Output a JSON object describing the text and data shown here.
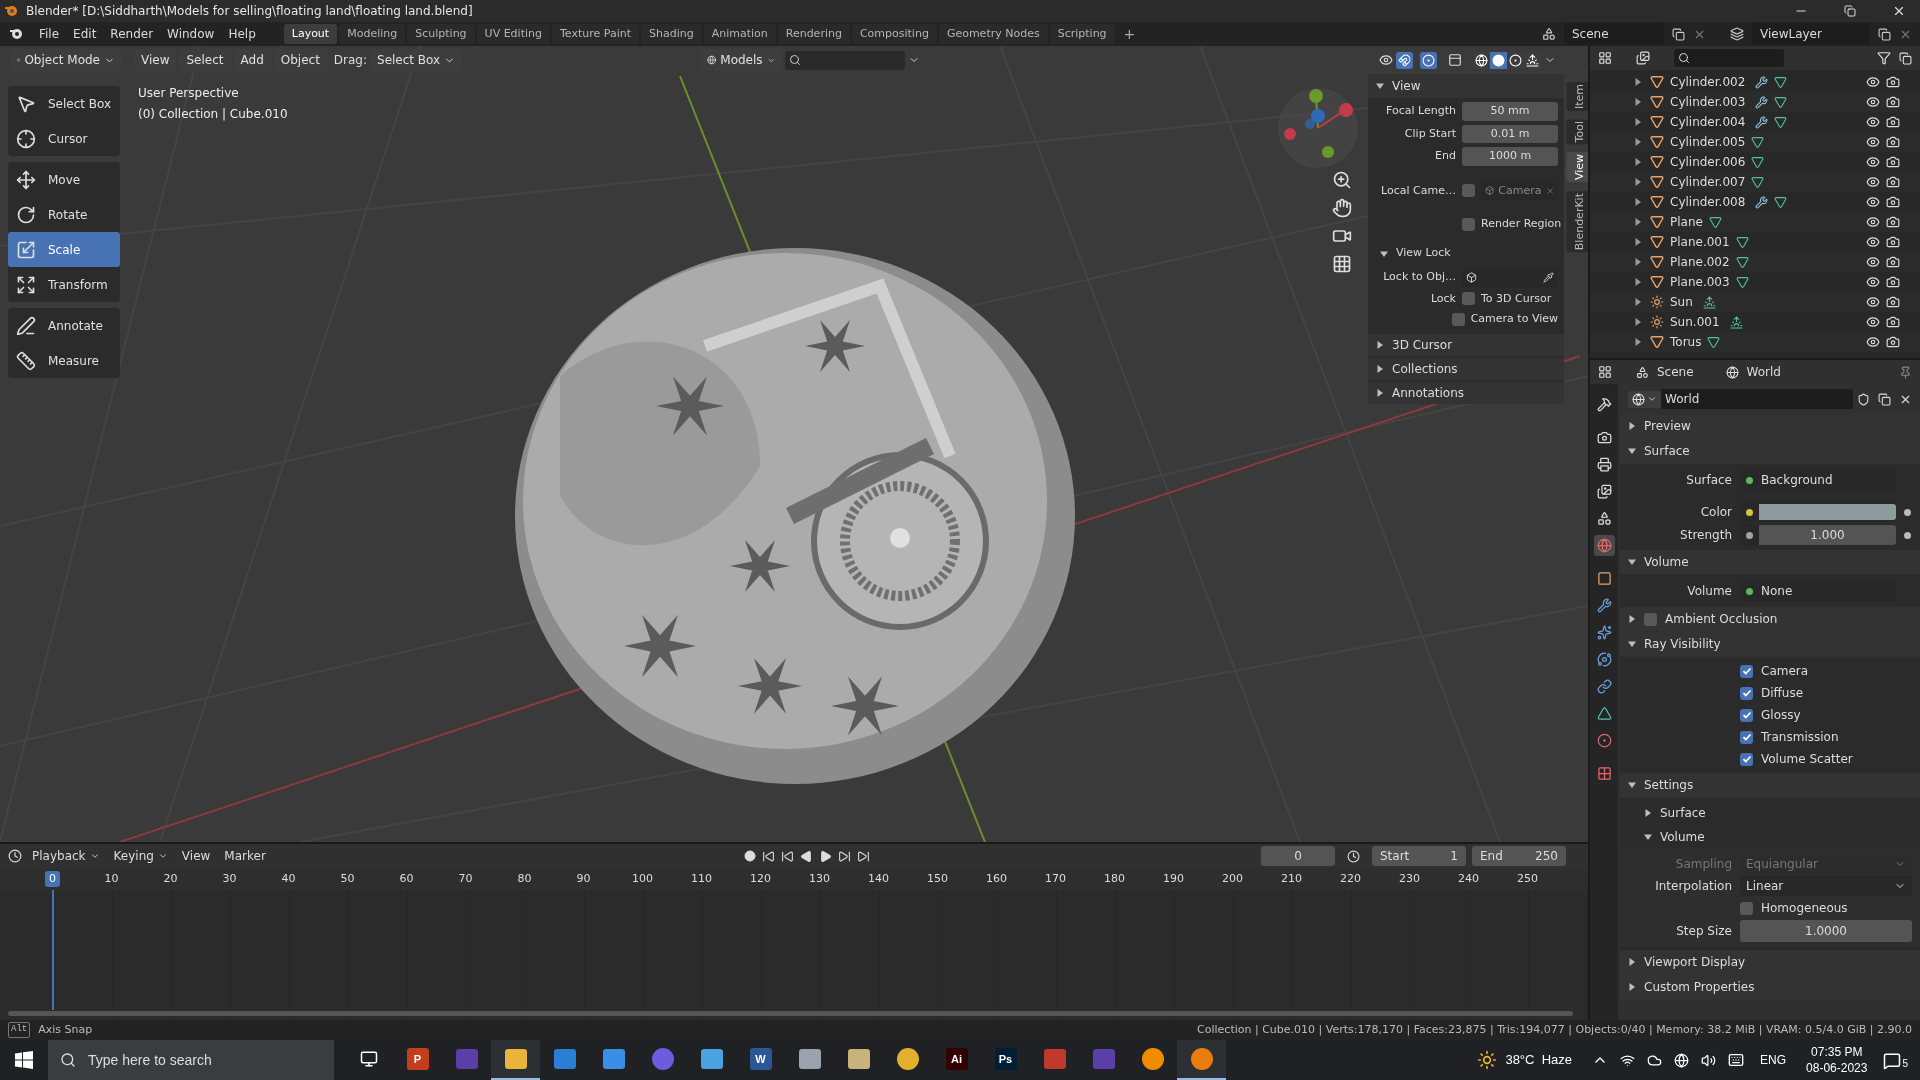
{
  "title_bar": {
    "title": "Blender* [D:\\Siddharth\\Models for selling\\floating land\\floating land.blend]"
  },
  "menu": [
    "File",
    "Edit",
    "Render",
    "Window",
    "Help"
  ],
  "workspaces": [
    {
      "label": "Layout",
      "selected": true
    },
    {
      "label": "Modeling",
      "selected": false
    },
    {
      "label": "Sculpting",
      "selected": false
    },
    {
      "label": "UV Editing",
      "selected": false
    },
    {
      "label": "Texture Paint",
      "selected": false
    },
    {
      "label": "Shading",
      "selected": false
    },
    {
      "label": "Animation",
      "selected": false
    },
    {
      "label": "Rendering",
      "selected": false
    },
    {
      "label": "Compositing",
      "selected": false
    },
    {
      "label": "Geometry Nodes",
      "selected": false
    },
    {
      "label": "Scripting",
      "selected": false
    }
  ],
  "add_workspace": "+",
  "scene": "Scene",
  "view_layer": "ViewLayer",
  "viewport": {
    "header": {
      "mode": "Object Mode",
      "menus": [
        "View",
        "Select",
        "Add",
        "Object"
      ],
      "drag_label": "Drag:",
      "drag_value": "Select Box",
      "orientation": "Models",
      "shading": [
        {
          "kind": "wireframe",
          "selected": false
        },
        {
          "kind": "solid",
          "selected": true
        },
        {
          "kind": "material",
          "selected": false
        },
        {
          "kind": "rendered",
          "selected": false
        }
      ]
    },
    "overlay_text": [
      "User Perspective",
      "(0) Collection | Cube.010"
    ],
    "tool_groups": [
      [
        {
          "label": "Select Box",
          "kind": "select",
          "selected": false
        },
        {
          "label": "Cursor",
          "kind": "cursor",
          "selected": false
        }
      ],
      [
        {
          "label": "Move",
          "kind": "move",
          "selected": false
        },
        {
          "label": "Rotate",
          "kind": "rotate",
          "selected": false
        },
        {
          "label": "Scale",
          "kind": "scale",
          "selected": true
        },
        {
          "label": "Transform",
          "kind": "transform",
          "selected": false
        }
      ],
      [
        {
          "label": "Annotate",
          "kind": "annotate",
          "selected": false
        },
        {
          "label": "Measure",
          "kind": "measure",
          "selected": false
        }
      ]
    ],
    "n_panel": {
      "tabs": [
        {
          "label": "Item",
          "selected": false
        },
        {
          "label": "Tool",
          "selected": false
        },
        {
          "label": "View",
          "selected": true
        },
        {
          "label": "BlenderKit",
          "selected": false
        }
      ],
      "view": {
        "title": "View",
        "expanded": true,
        "fields": [
          {
            "label": "Focal Length",
            "value": "50 mm"
          },
          {
            "label": "Clip Start",
            "value": "0.01 m"
          },
          {
            "label": "End",
            "value": "1000 m"
          }
        ],
        "local_camera": {
          "label": "Local Came…",
          "checked": false,
          "placeholder": "Camera"
        },
        "render_region": {
          "label": "Render Region",
          "checked": false
        },
        "view_lock": {
          "title": "View Lock",
          "expanded": true,
          "lock_to_label": "Lock to Obj…",
          "lock_label": "Lock",
          "options": [
            {
              "label": "To 3D Cursor",
              "checked": false
            },
            {
              "label": "Camera to View",
              "checked": false
            }
          ]
        }
      },
      "sections": [
        {
          "title": "3D Cursor",
          "expanded": false
        },
        {
          "title": "Collections",
          "expanded": false
        },
        {
          "title": "Annotations",
          "expanded": false
        }
      ]
    }
  },
  "outliner": {
    "items": [
      {
        "name": "Cylinder.002",
        "kind": "mesh",
        "modifier": true
      },
      {
        "name": "Cylinder.003",
        "kind": "mesh",
        "modifier": true
      },
      {
        "name": "Cylinder.004",
        "kind": "mesh",
        "modifier": true
      },
      {
        "name": "Cylinder.005",
        "kind": "mesh",
        "modifier": false
      },
      {
        "name": "Cylinder.006",
        "kind": "mesh",
        "modifier": false
      },
      {
        "name": "Cylinder.007",
        "kind": "mesh",
        "modifier": false
      },
      {
        "name": "Cylinder.008",
        "kind": "mesh",
        "modifier": true
      },
      {
        "name": "Plane",
        "kind": "mesh",
        "modifier": false
      },
      {
        "name": "Plane.001",
        "kind": "mesh",
        "modifier": false
      },
      {
        "name": "Plane.002",
        "kind": "mesh",
        "modifier": false
      },
      {
        "name": "Plane.003",
        "kind": "mesh",
        "modifier": false
      },
      {
        "name": "Sun",
        "kind": "light",
        "modifier": false
      },
      {
        "name": "Sun.001",
        "kind": "light",
        "modifier": false
      },
      {
        "name": "Torus",
        "kind": "mesh",
        "modifier": false
      }
    ]
  },
  "properties": {
    "context": [
      "Scene",
      "World"
    ],
    "datablock": "World",
    "tabs": [
      {
        "kind": "tool",
        "selected": false
      },
      {
        "kind": "render",
        "selected": false
      },
      {
        "kind": "output",
        "selected": false
      },
      {
        "kind": "view_layer",
        "selected": false
      },
      {
        "kind": "scene",
        "selected": false
      },
      {
        "kind": "world",
        "selected": true
      },
      {
        "kind": "object",
        "selected": false
      },
      {
        "kind": "modifiers",
        "selected": false
      },
      {
        "kind": "particles",
        "selected": false
      },
      {
        "kind": "physics",
        "selected": false
      },
      {
        "kind": "constraints",
        "selected": false
      },
      {
        "kind": "data",
        "selected": false
      },
      {
        "kind": "material",
        "selected": false
      },
      {
        "kind": "texture",
        "selected": false
      }
    ],
    "panels": [
      {
        "title": "Preview",
        "expanded": false
      },
      {
        "title": "Surface",
        "expanded": true,
        "rows": [
          {
            "kind": "socket",
            "label": "Surface",
            "value": "Background",
            "color": "#5cb85c"
          },
          {
            "kind": "color",
            "label": "Color",
            "color": "#8e9b9d"
          },
          {
            "kind": "number",
            "label": "Strength",
            "value": "1.000",
            "color": "#a3a3a3"
          }
        ]
      },
      {
        "title": "Volume",
        "expanded": true,
        "rows": [
          {
            "kind": "socket",
            "label": "Volume",
            "value": "None",
            "color": "#5cb85c"
          }
        ]
      },
      {
        "title": "Ambient Occlusion",
        "expanded": false,
        "checked": false
      },
      {
        "title": "Ray Visibility",
        "expanded": true,
        "rows": [
          {
            "kind": "checkbox",
            "label": "Camera",
            "checked": true
          },
          {
            "kind": "checkbox",
            "label": "Diffuse",
            "checked": true
          },
          {
            "kind": "checkbox",
            "label": "Glossy",
            "checked": true
          },
          {
            "kind": "checkbox",
            "label": "Transmission",
            "checked": true
          },
          {
            "kind": "checkbox",
            "label": "Volume Scatter",
            "checked": true
          }
        ]
      },
      {
        "title": "Settings",
        "expanded": true,
        "rows": [
          {
            "kind": "subpanel",
            "title": "Surface",
            "expanded": false
          },
          {
            "kind": "subpanel",
            "title": "Volume",
            "expanded": true,
            "rows": [
              {
                "kind": "dropdown",
                "label": "Sampling",
                "value": "Equiangular",
                "disabled": true
              },
              {
                "kind": "dropdown",
                "label": "Interpolation",
                "value": "Linear",
                "disabled": false
              },
              {
                "kind": "checkbox",
                "label": "Homogeneous",
                "checked": false
              },
              {
                "kind": "number",
                "label": "Step Size",
                "value": "1.0000"
              }
            ]
          }
        ]
      },
      {
        "title": "Viewport Display",
        "expanded": false
      },
      {
        "title": "Custom Properties",
        "expanded": false
      }
    ]
  },
  "timeline": {
    "menus": [
      "Playback",
      "Keying",
      "View",
      "Marker"
    ],
    "current_frame": "0",
    "start_label": "Start",
    "start": "1",
    "end_label": "End",
    "end": "250",
    "ticks": [
      {
        "label": "0",
        "selected": true
      },
      {
        "label": "10",
        "selected": false
      },
      {
        "label": "20",
        "selected": false
      },
      {
        "label": "30",
        "selected": false
      },
      {
        "label": "40",
        "selected": false
      },
      {
        "label": "50",
        "selected": false
      },
      {
        "label": "60",
        "selected": false
      },
      {
        "label": "70",
        "selected": false
      },
      {
        "label": "80",
        "selected": false
      },
      {
        "label": "90",
        "selected": false
      },
      {
        "label": "100",
        "selected": false
      },
      {
        "label": "110",
        "selected": false
      },
      {
        "label": "120",
        "selected": false
      },
      {
        "label": "130",
        "selected": false
      },
      {
        "label": "140",
        "selected": false
      },
      {
        "label": "150",
        "selected": false
      },
      {
        "label": "160",
        "selected": false
      },
      {
        "label": "170",
        "selected": false
      },
      {
        "label": "180",
        "selected": false
      },
      {
        "label": "190",
        "selected": false
      },
      {
        "label": "200",
        "selected": false
      },
      {
        "label": "210",
        "selected": false
      },
      {
        "label": "220",
        "selected": false
      },
      {
        "label": "230",
        "selected": false
      },
      {
        "label": "240",
        "selected": false
      },
      {
        "label": "250",
        "selected": false
      }
    ]
  },
  "status_bar": {
    "key": "Alt",
    "hint": "Axis Snap",
    "stats": "Collection | Cube.010 | Verts:178,170 | Faces:23,875 | Tris:194,077 | Objects:0/40 | Memory: 38.2 MiB | VRAM: 0.5/4.0 GiB | 2.90.0"
  },
  "taskbar": {
    "search_placeholder": "Type here to search",
    "apps": [
      {
        "kind": "taskview",
        "running": false
      },
      {
        "kind": "letter",
        "label": "P",
        "color": "#c43e1c",
        "running": false
      },
      {
        "kind": "tile",
        "color": "#5b3fa8",
        "running": false
      },
      {
        "kind": "tile",
        "color": "#e8b53a",
        "running": true
      },
      {
        "kind": "tile",
        "color": "#2a7fd4",
        "running": false
      },
      {
        "kind": "tile",
        "color": "#3a8ee6",
        "running": false
      },
      {
        "kind": "round",
        "color": "#6d5ce0",
        "running": false
      },
      {
        "kind": "tile",
        "color": "#4aa3e0",
        "running": false
      },
      {
        "kind": "letter",
        "label": "W",
        "color": "#2b5797",
        "running": false
      },
      {
        "kind": "tile",
        "color": "#9aa3ad",
        "running": false
      },
      {
        "kind": "tile",
        "color": "#c9b37a",
        "running": false
      },
      {
        "kind": "round",
        "color": "#e2b02c",
        "running": false
      },
      {
        "kind": "letter",
        "label": "Ai",
        "color": "#330000",
        "running": false
      },
      {
        "kind": "letter",
        "label": "Ps",
        "color": "#001e36",
        "running": false
      },
      {
        "kind": "tile",
        "color": "#c0392b",
        "running": false
      },
      {
        "kind": "tile",
        "color": "#5b3fa8",
        "running": false
      },
      {
        "kind": "round",
        "color": "#f08c00",
        "running": false
      },
      {
        "kind": "round",
        "color": "#e87d0d",
        "running": true
      }
    ],
    "weather": "38°C  Haze",
    "language": "ENG",
    "time": "07:35 PM",
    "date": "08-06-2023",
    "notifications": "5"
  }
}
